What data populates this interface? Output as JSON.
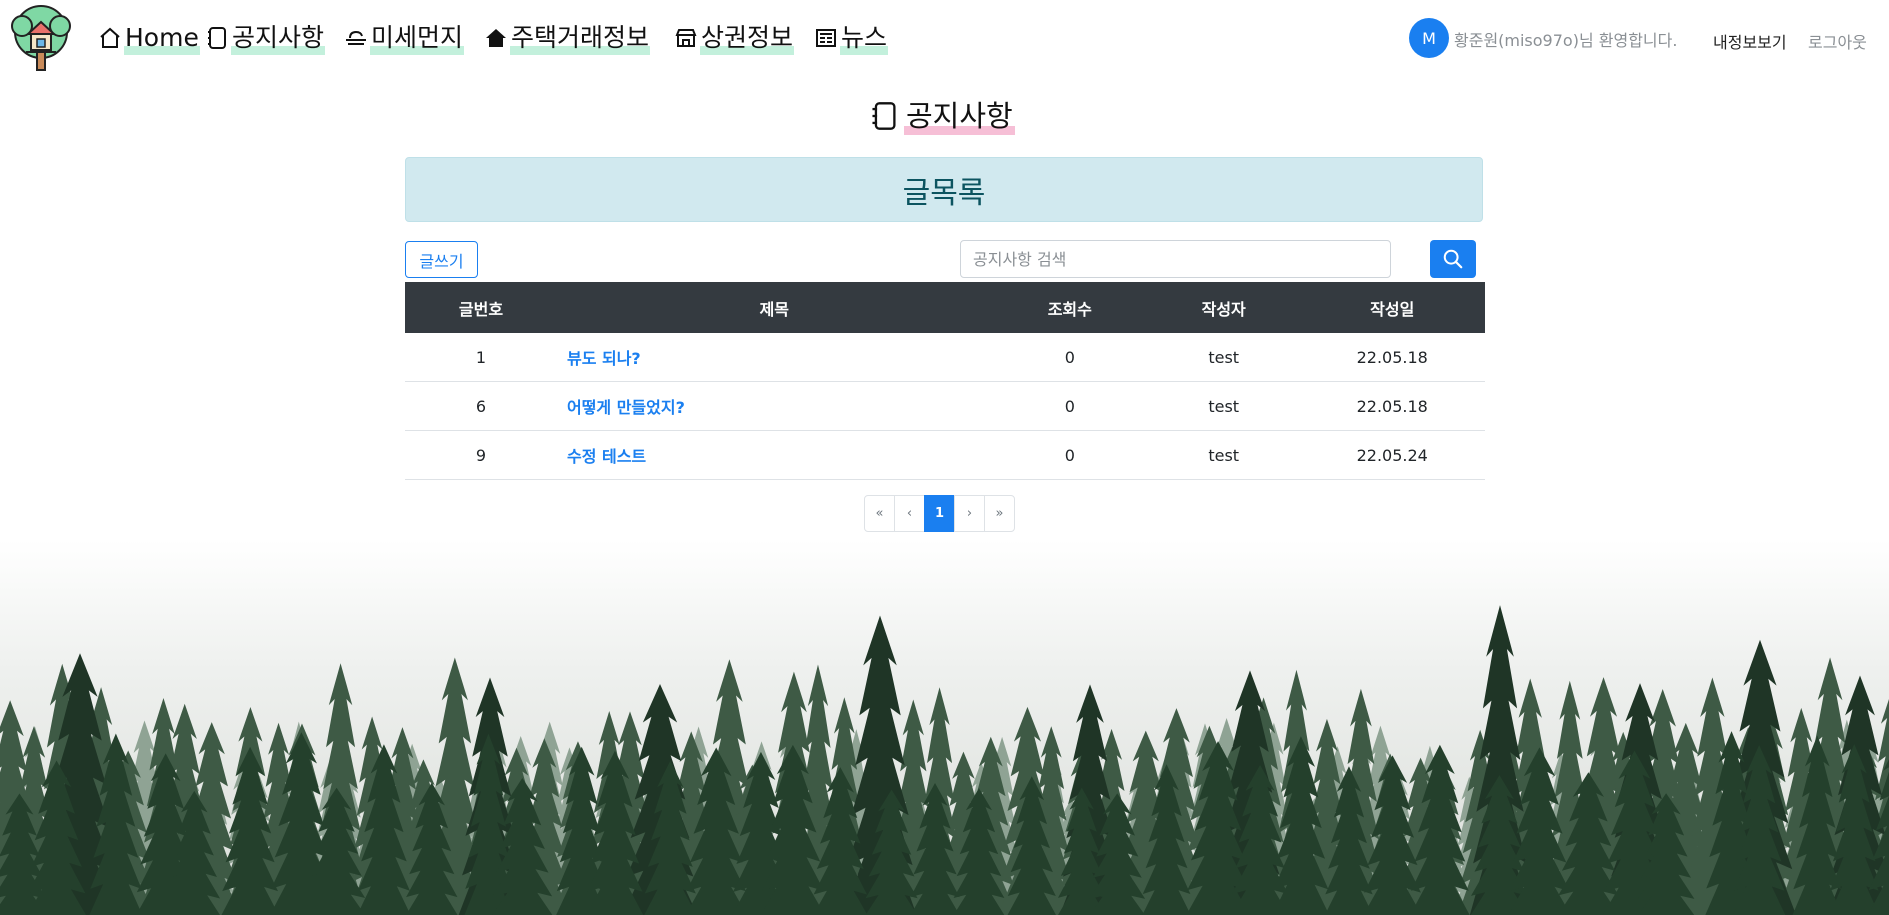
{
  "nav": {
    "items": [
      {
        "icon": "home-icon",
        "label": "Home"
      },
      {
        "icon": "notebook-icon",
        "label": "공지사항"
      },
      {
        "icon": "smog-icon",
        "label": "미세먼지"
      },
      {
        "icon": "house-icon",
        "label": "주택거래정보"
      },
      {
        "icon": "store-icon",
        "label": "상권정보"
      },
      {
        "icon": "newspaper-icon",
        "label": "뉴스"
      }
    ],
    "avatar_letter": "M",
    "welcome": "황준원(miso97o)님 환영합니다.",
    "mypage": "내정보보기",
    "logout": "로그아웃"
  },
  "page": {
    "title": "공지사항",
    "banner": "글목록"
  },
  "toolbar": {
    "write_label": "글쓰기",
    "search_placeholder": "공지사항 검색"
  },
  "table": {
    "headers": [
      "글번호",
      "제목",
      "조회수",
      "작성자",
      "작성일"
    ],
    "rows": [
      {
        "no": "1",
        "title": "뷰도 되나?",
        "views": "0",
        "author": "test",
        "date": "22.05.18"
      },
      {
        "no": "6",
        "title": "어떻게 만들었지?",
        "views": "0",
        "author": "test",
        "date": "22.05.18"
      },
      {
        "no": "9",
        "title": "수정 테스트",
        "views": "0",
        "author": "test",
        "date": "22.05.24"
      }
    ]
  },
  "pagination": {
    "first": "«",
    "prev": "‹",
    "current": "1",
    "next": "›",
    "last": "»"
  },
  "colors": {
    "primary": "#1a7ff0",
    "table_header": "#343a40",
    "banner_bg": "#d1e9ef",
    "banner_text": "#0c5460",
    "nav_highlight": "#c3f0dc",
    "title_highlight": "#f6bfd6"
  }
}
